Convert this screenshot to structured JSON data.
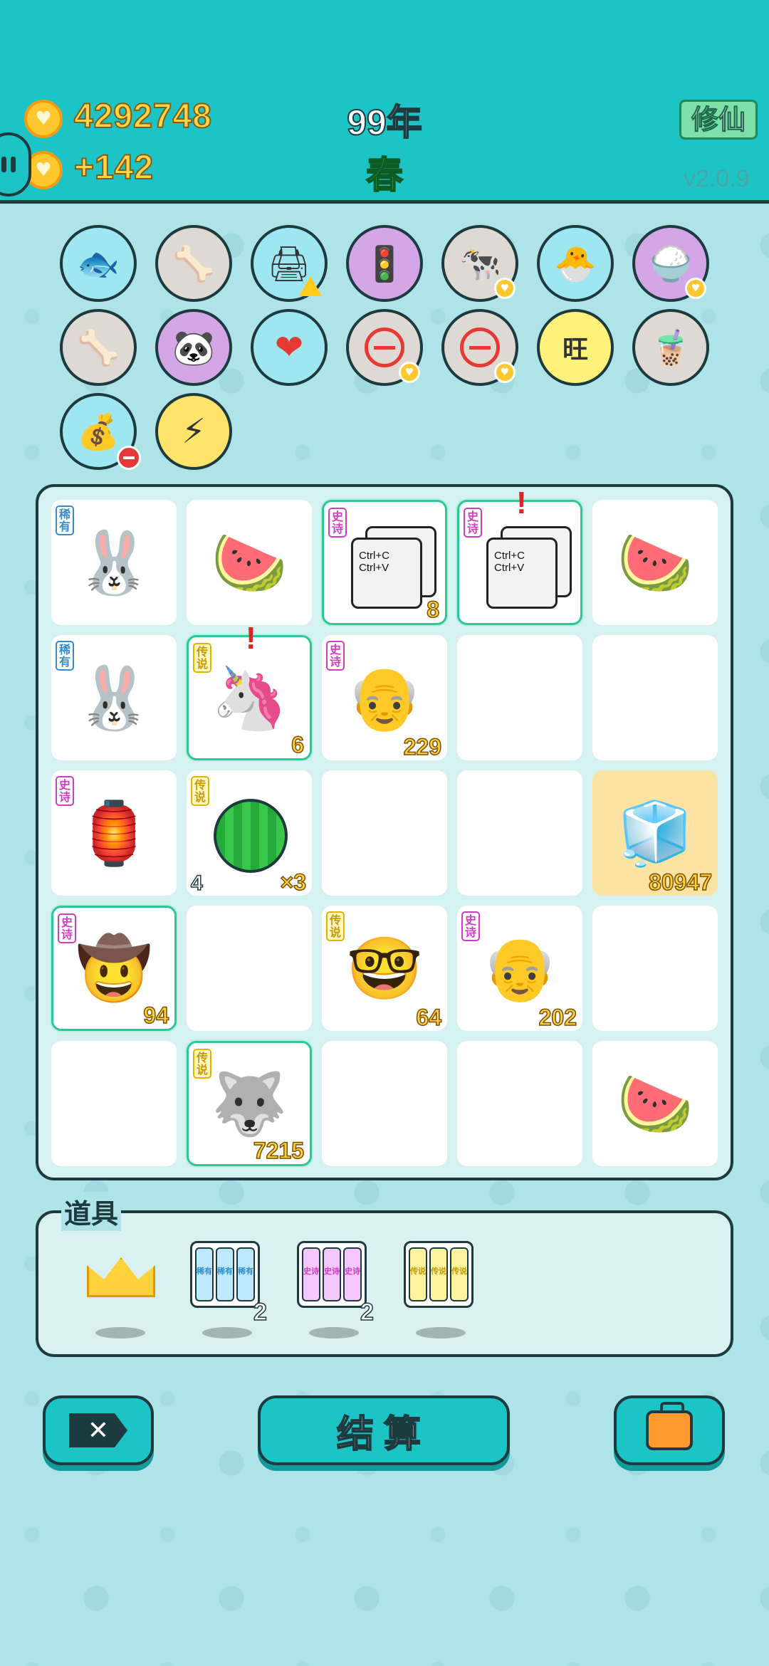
{
  "header": {
    "coins": "4292748",
    "coin_income": "+142",
    "year": "99年",
    "season": "春",
    "mode_button": "修仙",
    "version": "v2.0.9"
  },
  "items_row1": [
    {
      "icon": "fish-bowl-icon",
      "glyph": "🐟",
      "bg": "blue"
    },
    {
      "icon": "pet-food-bowl-icon",
      "glyph": "🦴",
      "bg": "grey"
    },
    {
      "icon": "printer-icon",
      "glyph": "🖨",
      "bg": "blue",
      "badge": "warn"
    },
    {
      "icon": "traffic-light-icon",
      "glyph": "🚦",
      "bg": "purple"
    },
    {
      "icon": "cows-icon",
      "glyph": "🐄",
      "bg": "grey",
      "badge": "heart"
    },
    {
      "icon": "chick-egg-icon",
      "glyph": "🐣",
      "bg": "blue"
    },
    {
      "icon": "rice-bowl-icon",
      "glyph": "🍚",
      "bg": "purple",
      "badge": "heart"
    }
  ],
  "items_row2": [
    {
      "icon": "pet-food-bowl-icon",
      "glyph": "🦴",
      "bg": "grey"
    },
    {
      "icon": "panda-icon",
      "glyph": "🐼",
      "bg": "purple"
    },
    {
      "icon": "blood-bag-icon",
      "glyph": "❤",
      "bg": "blue"
    },
    {
      "icon": "no-entry-icon",
      "glyph": "",
      "bg": "grey",
      "badge": "heart"
    },
    {
      "icon": "no-entry-icon",
      "glyph": "",
      "bg": "grey",
      "badge": "heart"
    },
    {
      "icon": "wang-text-icon",
      "glyph": "旺",
      "bg": "yellow"
    },
    {
      "icon": "milk-tea-icon",
      "glyph": "🧋",
      "bg": "grey"
    }
  ],
  "items_row3": [
    {
      "icon": "money-bag-icon",
      "glyph": "💰",
      "bg": "blue",
      "badge": "minus"
    },
    {
      "icon": "lightning-icon",
      "glyph": "⚡",
      "bg": "gold"
    }
  ],
  "board": {
    "rows": [
      [
        {
          "glyph": "🐰",
          "name": "rabbit",
          "rarity": "稀有",
          "rarity_color": "blue"
        },
        {
          "glyph": "🍉",
          "name": "watermelon-slice"
        },
        {
          "glyph": "",
          "name": "ctrl-c-ctrl-v",
          "rarity": "史诗",
          "rarity_color": "pink",
          "count": "8",
          "highlight": true,
          "paper": "Ctrl+C Ctrl+V"
        },
        {
          "glyph": "",
          "name": "ctrl-c-ctrl-v",
          "rarity": "史诗",
          "rarity_color": "pink",
          "highlight": true,
          "alert": true,
          "paper": "Ctrl+C Ctrl+V"
        },
        {
          "glyph": "🍉",
          "name": "watermelon-slice"
        }
      ],
      [
        {
          "glyph": "🐰",
          "name": "rabbit",
          "rarity": "稀有",
          "rarity_color": "blue"
        },
        {
          "glyph": "🦄",
          "name": "unicorn",
          "rarity": "传说",
          "rarity_color": "yellow",
          "count": "6",
          "highlight": true,
          "alert": true
        },
        {
          "glyph": "👴",
          "name": "bearded-man",
          "rarity": "史诗",
          "rarity_color": "pink",
          "count": "229"
        },
        {
          "glyph": "",
          "name": "empty"
        },
        {
          "glyph": "",
          "name": "empty"
        }
      ],
      [
        {
          "glyph": "🏮",
          "name": "rabbit-tent",
          "rarity": "史诗",
          "rarity_color": "pink"
        },
        {
          "glyph": "",
          "name": "watermelon",
          "rarity": "传说",
          "rarity_color": "yellow",
          "left_num": "4",
          "count": "×3",
          "melon": true
        },
        {
          "glyph": "",
          "name": "empty"
        },
        {
          "glyph": "",
          "name": "empty"
        },
        {
          "glyph": "🧊",
          "name": "fridge",
          "count": "80947",
          "fridge": true
        }
      ],
      [
        {
          "glyph": "🤠",
          "name": "cowboy-man",
          "rarity": "史诗",
          "rarity_color": "pink",
          "count": "94",
          "highlight": true
        },
        {
          "glyph": "",
          "name": "empty"
        },
        {
          "glyph": "🤓",
          "name": "bald-glasses-man",
          "rarity": "传说",
          "rarity_color": "yellow",
          "count": "64"
        },
        {
          "glyph": "👴",
          "name": "bearded-man",
          "rarity": "史诗",
          "rarity_color": "pink",
          "count": "202"
        },
        {
          "glyph": "",
          "name": "empty"
        }
      ],
      [
        {
          "glyph": "",
          "name": "empty"
        },
        {
          "glyph": "🐺",
          "name": "husky-king",
          "rarity": "传说",
          "rarity_color": "yellow",
          "count": "7215",
          "highlight": true
        },
        {
          "glyph": "",
          "name": "empty"
        },
        {
          "glyph": "",
          "name": "empty"
        },
        {
          "glyph": "🍉",
          "name": "watermelon-slice"
        }
      ]
    ]
  },
  "props": {
    "label": "道具",
    "items": [
      {
        "name": "crown",
        "count": ""
      },
      {
        "name": "rare-cards",
        "label": "稀有",
        "count": "2"
      },
      {
        "name": "epic-cards",
        "label": "史诗",
        "count": "2"
      },
      {
        "name": "legend-cards",
        "label": "传说",
        "count": ""
      }
    ]
  },
  "buttons": {
    "close": "✕",
    "settle": "结算"
  }
}
